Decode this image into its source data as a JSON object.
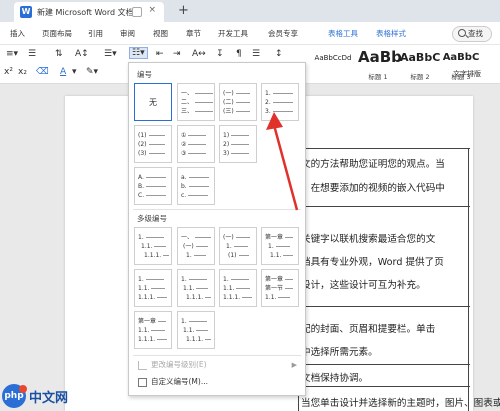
{
  "title_bar": {
    "app_icon": "W",
    "doc_title": "新建 Microsoft Word 文档",
    "new_tab": "+",
    "close": "×"
  },
  "menu": {
    "items": [
      "插入",
      "页面布局",
      "引用",
      "审阅",
      "视图",
      "章节",
      "开发工具",
      "会员专享"
    ],
    "context_tabs": [
      "表格工具",
      "表格样式"
    ],
    "search_label": "查找"
  },
  "toolbar": {
    "row2_left": "A",
    "styles": [
      {
        "preview": "AaBbCcDd",
        "caption": ""
      },
      {
        "preview": "AaBb",
        "caption": "标题 1"
      },
      {
        "preview": "AaBbC",
        "caption": "标题 2"
      },
      {
        "preview": "AaBbC",
        "caption": "标题 3"
      }
    ],
    "text_layout_label": "文字排版",
    "accent_color": "#2b6fd6"
  },
  "panel": {
    "numbering_label": "编号",
    "none_label": "无",
    "numbering_cells": [
      [
        "一、",
        "二、",
        "三、"
      ],
      [
        "(一)",
        "(二)",
        "(三)"
      ],
      [
        "1.",
        "2.",
        "3."
      ],
      [
        "(1)",
        "(2)",
        "(3)"
      ],
      [
        "①",
        "②",
        "③"
      ],
      [
        "1)",
        "2)",
        "3)"
      ],
      [
        "A.",
        "B.",
        "C."
      ],
      [
        "a.",
        "b.",
        "c."
      ]
    ],
    "multilevel_label": "多级编号",
    "multilevel_cells": [
      [
        "1.",
        "1.1.",
        "1.1.1."
      ],
      [
        "一、",
        "(一)",
        "1."
      ],
      [
        "(一)",
        "1.",
        "(1)"
      ],
      [
        "第一章",
        "1.",
        "1.1."
      ],
      [
        "1.",
        "1.1.",
        "1.1.1."
      ],
      [
        "1.",
        "1.1.",
        "1.1.1."
      ],
      [
        "1.",
        "1.1.",
        "1.1.1."
      ],
      [
        "第一章",
        "第一节",
        "1.1."
      ],
      [
        "第一章",
        "1.1.",
        "1.1.1."
      ],
      [
        "1.",
        "1.1.",
        "1.1.1."
      ]
    ],
    "change_level": "更改编号级别(E)",
    "custom_numbering": "自定义编号(M)..."
  },
  "document": {
    "lines": [
      "文的方法帮助您证明您的观点。当",
      "，在想要添加的视频的嵌入代码中",
      "关键字以联机搜索最适合您的文",
      "档具有专业外观，Word 提供了页",
      "设计，这些设计可互为补充。",
      "配的封面、页眉和提要栏。单击",
      "中选择所需元素。",
      "文档保持协调。",
      "当您单击设计并选择新的主题时，图片、图表或"
    ]
  },
  "watermark": {
    "brand": "中文网",
    "logo_text": "php",
    "domain": ""
  }
}
